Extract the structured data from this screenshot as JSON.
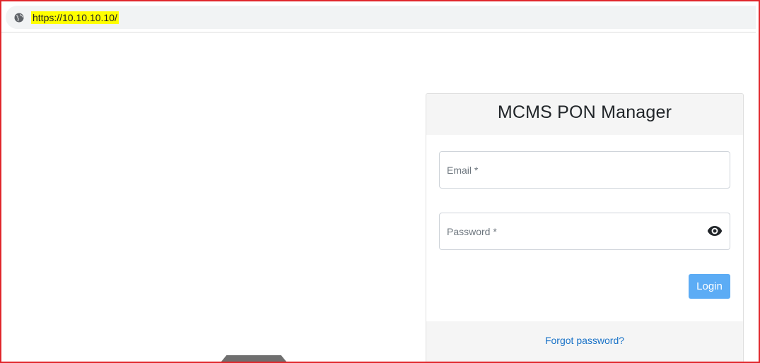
{
  "browser": {
    "url": "https://10.10.10.10/",
    "icon": "globe-icon"
  },
  "login": {
    "title": "MCMS PON Manager",
    "email_placeholder": "Email *",
    "email_value": "",
    "password_placeholder": "Password *",
    "password_value": "",
    "show_password_icon": "eye-icon",
    "login_label": "Login",
    "forgot_label": "Forgot password?"
  },
  "colors": {
    "frame": "#e0262b",
    "url_highlight": "#ffff00",
    "button": "#5cacf5",
    "link": "#1a73c8"
  }
}
